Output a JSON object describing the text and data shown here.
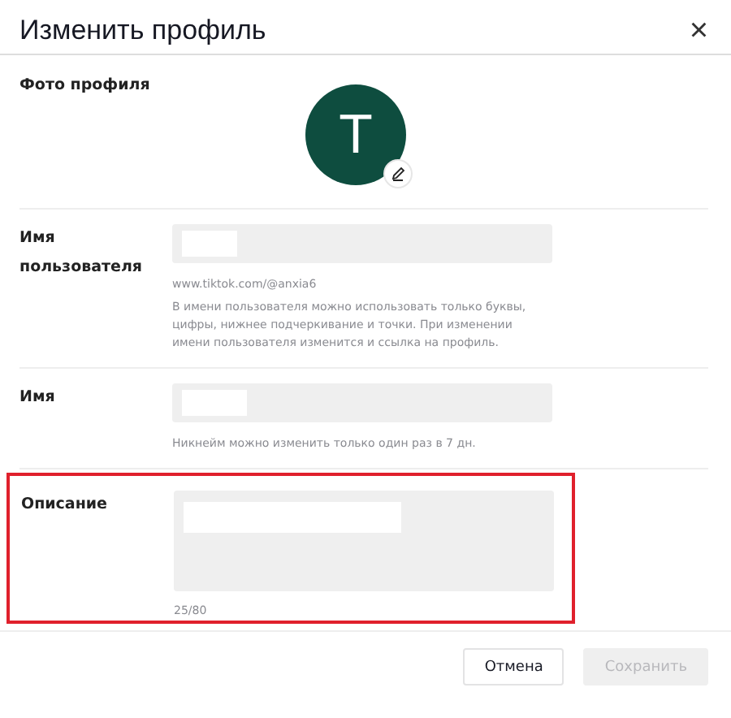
{
  "dialog": {
    "title": "Изменить профиль",
    "close": "×"
  },
  "photo": {
    "label": "Фото профиля",
    "avatar_letter": "T"
  },
  "username": {
    "label": "Имя пользователя",
    "url": "www.tiktok.com/@anxia6",
    "help": "В имени пользователя можно использовать только буквы, цифры, нижнее подчеркивание и точки. При изменении имени пользователя изменится и ссылка на профиль."
  },
  "name": {
    "label": "Имя",
    "help": "Никнейм можно изменить только один раз в 7 дн."
  },
  "description": {
    "label": "Описание",
    "counter": "25/80",
    "highlighted": true
  },
  "buttons": [
    {
      "label": "Отмена",
      "disabled": false
    },
    {
      "label": "Сохранить",
      "disabled": true
    }
  ]
}
